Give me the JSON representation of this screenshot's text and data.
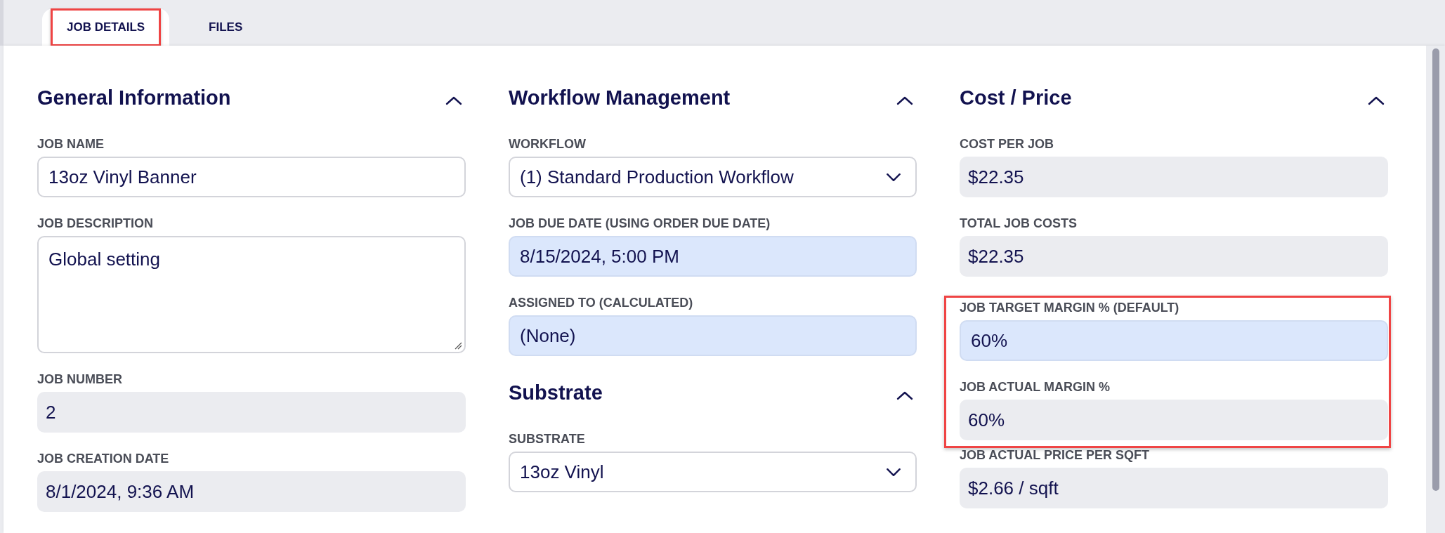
{
  "tabs": [
    {
      "label": "JOB DETAILS",
      "selected": true,
      "outlined": true
    },
    {
      "label": "FILES",
      "selected": false,
      "outlined": false
    }
  ],
  "columns": [
    {
      "sections": [
        {
          "title": "General Information",
          "expanded": true,
          "groups": [
            {
              "outlined": false,
              "fields": [
                {
                  "label": "JOB NAME",
                  "kind": "input",
                  "value": "13oz Vinyl Banner"
                },
                {
                  "label": "JOB DESCRIPTION",
                  "kind": "textarea",
                  "value": "Global setting"
                },
                {
                  "label": "JOB NUMBER",
                  "kind": "readonly",
                  "value": "2"
                },
                {
                  "label": "JOB CREATION DATE",
                  "kind": "readonly",
                  "value": "8/1/2024, 9:36 AM"
                }
              ]
            }
          ]
        }
      ]
    },
    {
      "sections": [
        {
          "title": "Workflow Management",
          "expanded": true,
          "groups": [
            {
              "outlined": false,
              "fields": [
                {
                  "label": "WORKFLOW",
                  "kind": "select",
                  "value": "(1) Standard Production Workflow"
                },
                {
                  "label": "JOB DUE DATE (USING ORDER DUE DATE)",
                  "kind": "calculated",
                  "value": "8/15/2024, 5:00 PM"
                },
                {
                  "label": "ASSIGNED TO (CALCULATED)",
                  "kind": "calculated",
                  "value": "(None)"
                }
              ]
            }
          ]
        },
        {
          "title": "Substrate",
          "expanded": true,
          "groups": [
            {
              "outlined": false,
              "fields": [
                {
                  "label": "SUBSTRATE",
                  "kind": "select",
                  "value": "13oz Vinyl"
                }
              ]
            }
          ]
        }
      ]
    },
    {
      "sections": [
        {
          "title": "Cost / Price",
          "expanded": true,
          "groups": [
            {
              "outlined": false,
              "fields": [
                {
                  "label": "COST PER JOB",
                  "kind": "readonly",
                  "value": "$22.35"
                },
                {
                  "label": "TOTAL JOB COSTS",
                  "kind": "readonly",
                  "value": "$22.35"
                }
              ]
            },
            {
              "outlined": true,
              "fields": [
                {
                  "label": "JOB TARGET MARGIN % (DEFAULT)",
                  "kind": "calculated",
                  "value": "60%"
                },
                {
                  "label": "JOB ACTUAL MARGIN %",
                  "kind": "readonly",
                  "value": "60%"
                }
              ]
            },
            {
              "outlined": false,
              "fields": [
                {
                  "label": "JOB ACTUAL PRICE PER SQFT",
                  "kind": "readonly",
                  "value": "$2.66 / sqft"
                }
              ]
            }
          ]
        }
      ]
    }
  ]
}
